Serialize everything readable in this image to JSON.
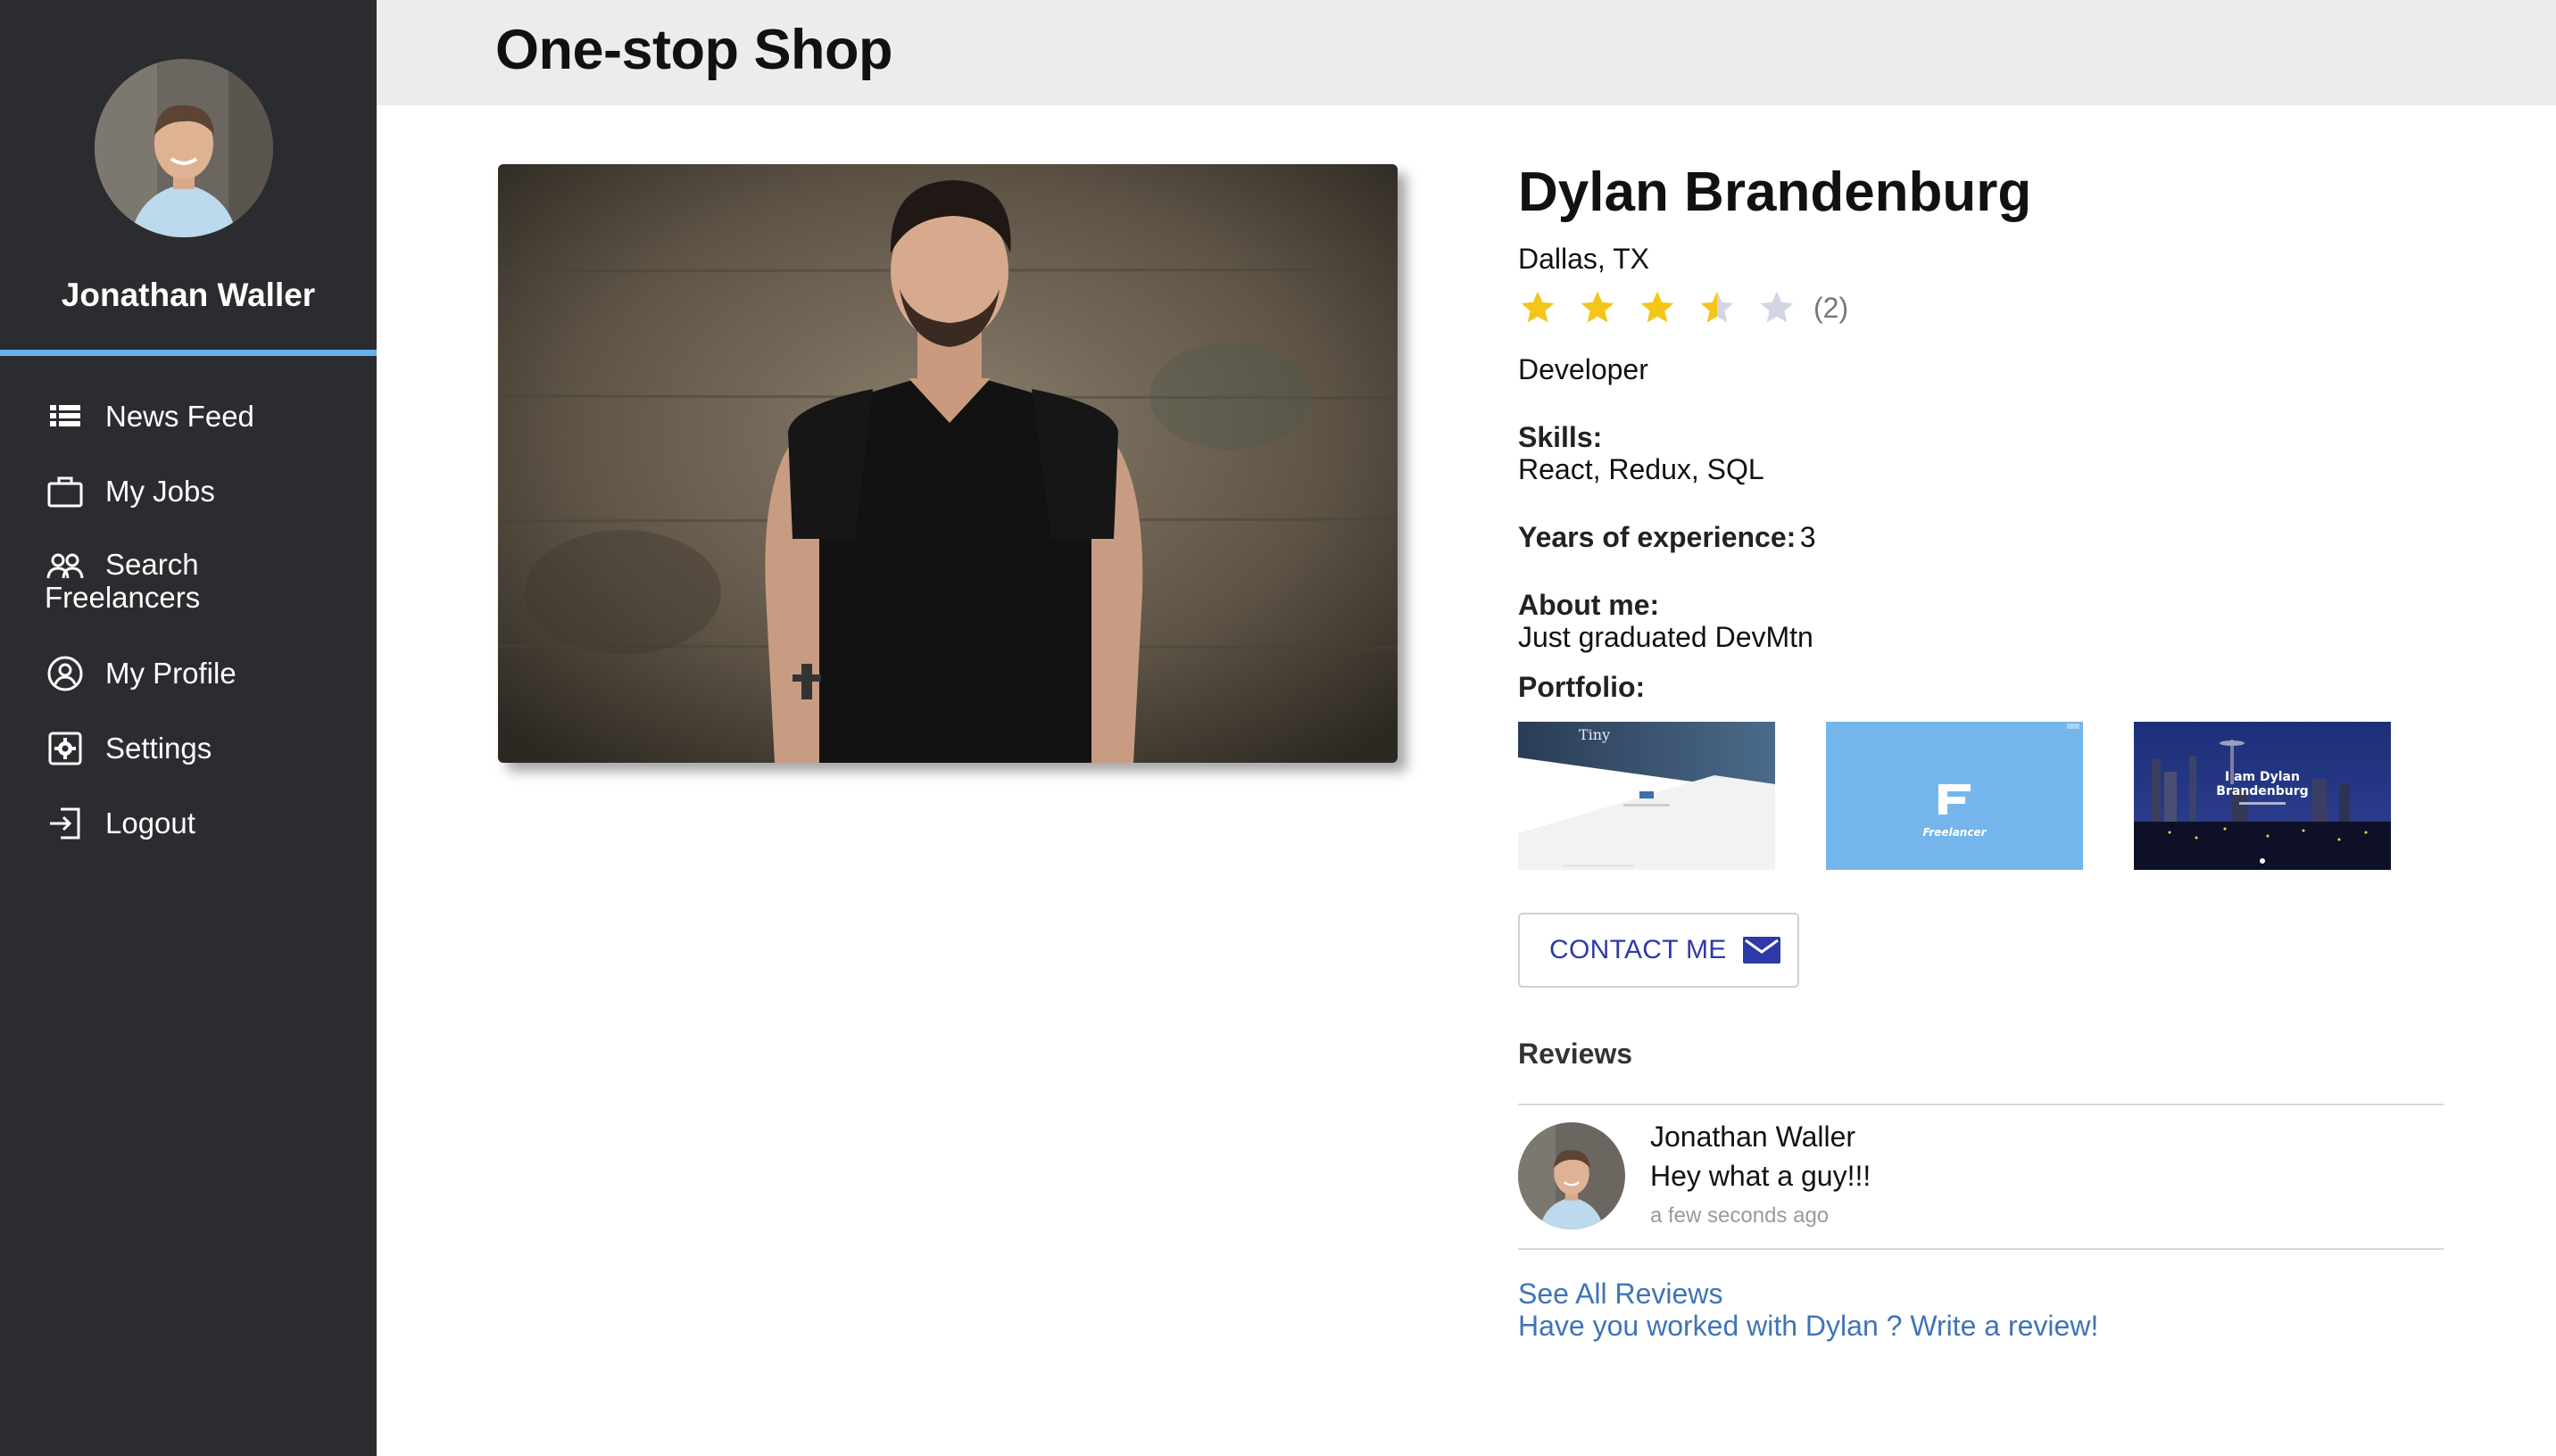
{
  "app": {
    "title": "One-stop Shop"
  },
  "sidebar": {
    "user_name": "Jonathan Waller",
    "items": [
      {
        "label": "News Feed",
        "icon": "list-icon"
      },
      {
        "label": "My Jobs",
        "icon": "briefcase-icon"
      },
      {
        "label": "Search Freelancers",
        "icon": "users-icon"
      },
      {
        "label": "My Profile",
        "icon": "user-circle-icon"
      },
      {
        "label": "Settings",
        "icon": "gear-icon"
      },
      {
        "label": "Logout",
        "icon": "logout-icon"
      }
    ]
  },
  "profile": {
    "name": "Dylan Brandenburg",
    "location": "Dallas, TX",
    "rating": 3.5,
    "rating_max": 5,
    "rating_count": "(2)",
    "role": "Developer",
    "skills_label": "Skills:",
    "skills": "React, Redux, SQL",
    "years_label": "Years of experience:",
    "years": "3",
    "about_label": "About me:",
    "about": "Just graduated DevMtn",
    "portfolio_label": "Portfolio:",
    "portfolio": [
      {
        "caption": "Tiny"
      },
      {
        "caption": "Freelancer"
      },
      {
        "caption_line1": "I am Dylan",
        "caption_line2": "Brandenburg"
      }
    ]
  },
  "contact": {
    "label": "CONTACT ME"
  },
  "reviews": {
    "label": "Reviews",
    "items": [
      {
        "author": "Jonathan Waller",
        "text": "Hey what a guy!!!",
        "time": "a few seconds ago"
      }
    ],
    "see_all": "See All Reviews",
    "write_prompt": "Have you worked with Dylan ? Write a review!"
  },
  "colors": {
    "sidebar_bg": "#2b2c2f",
    "sidebar_accent": "#6ab1e7",
    "header_bg": "#ececec",
    "star_filled": "#f5c518",
    "star_empty": "#d2d6e3",
    "link": "#3f74b6",
    "button_text": "#2e3aa8"
  }
}
